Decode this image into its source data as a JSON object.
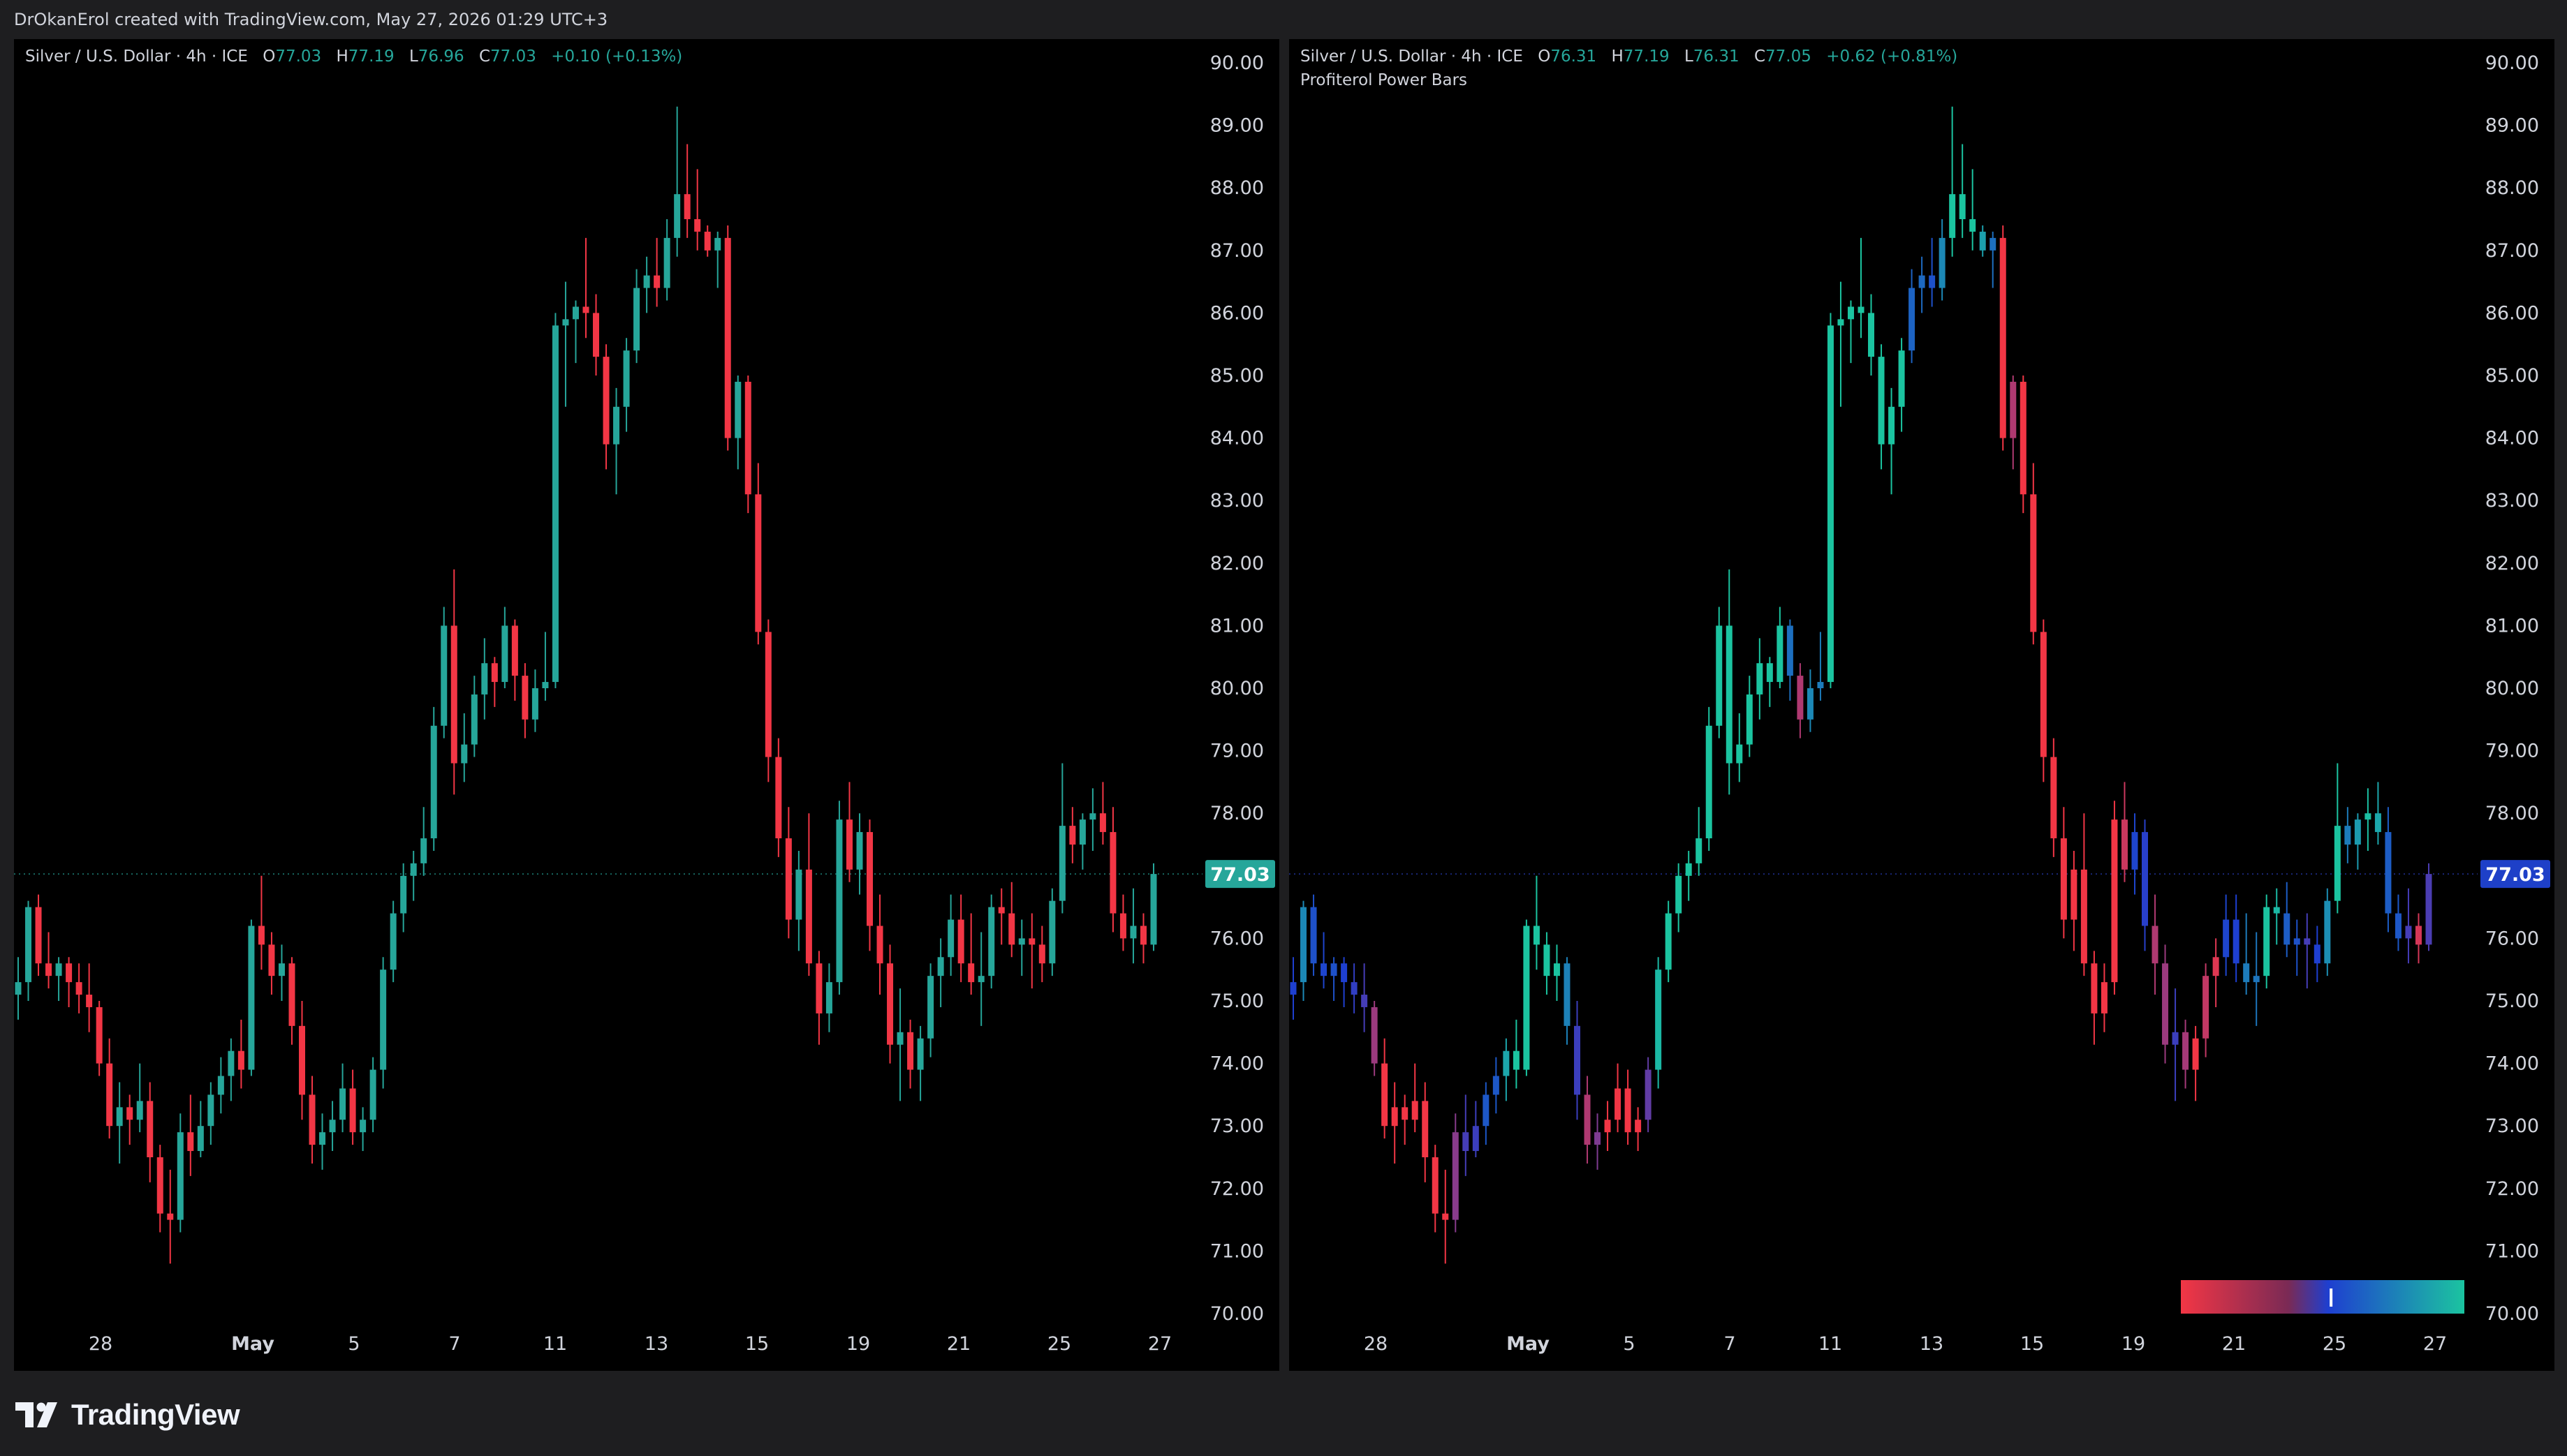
{
  "header": {
    "credit": "DrOkanErol created with TradingView.com, May 27, 2026 01:29 UTC+3"
  },
  "brand": {
    "name": "TradingView",
    "icon": "tradingview-logo-icon"
  },
  "colors": {
    "up": "#26a69a",
    "down": "#f23645",
    "background": "#000000",
    "frame": "#1e1e20",
    "gradient_bear": "#f23645",
    "gradient_neutral": "#1e3fd0",
    "gradient_bull": "#1bc4a0"
  },
  "left_pane": {
    "symbol": "Silver / U.S. Dollar · 4h · ICE",
    "ohlc": {
      "o_label": "O",
      "o": "77.03",
      "h_label": "H",
      "h": "77.19",
      "l_label": "L",
      "l": "76.96",
      "c_label": "C",
      "c": "77.03",
      "change": "+0.10 (+0.13%)"
    },
    "price_tag": "77.03"
  },
  "right_pane": {
    "symbol": "Silver / U.S. Dollar · 4h · ICE",
    "ohlc": {
      "o_label": "O",
      "o": "76.31",
      "h_label": "H",
      "h": "77.19",
      "l_label": "L",
      "l": "76.31",
      "c_label": "C",
      "c": "77.05",
      "change": "+0.62 (+0.81%)"
    },
    "indicator": "Profiterol Power Bars",
    "price_tag": "77.03"
  },
  "chart_data": [
    {
      "type": "candlestick",
      "title": "Silver / U.S. Dollar · 4h · ICE",
      "y_ticks": [
        "90.00",
        "89.00",
        "88.00",
        "87.00",
        "86.00",
        "85.00",
        "84.00",
        "83.00",
        "82.00",
        "81.00",
        "80.00",
        "79.00",
        "78.00",
        "77.00",
        "76.00",
        "75.00",
        "74.00",
        "73.00",
        "72.00",
        "71.00",
        "70.00"
      ],
      "ylim": [
        70,
        90
      ],
      "x_ticks": [
        "28",
        "May",
        "5",
        "7",
        "11",
        "13",
        "15",
        "19",
        "21",
        "25",
        "27"
      ],
      "last_price": 77.03,
      "ohlc": [
        [
          75.1,
          75.7,
          74.7,
          75.3
        ],
        [
          75.3,
          76.6,
          75.0,
          76.5
        ],
        [
          76.5,
          76.7,
          75.4,
          75.6
        ],
        [
          75.6,
          76.1,
          75.2,
          75.4
        ],
        [
          75.4,
          75.7,
          75.0,
          75.6
        ],
        [
          75.6,
          75.7,
          74.9,
          75.3
        ],
        [
          75.3,
          75.6,
          74.8,
          75.1
        ],
        [
          75.1,
          75.6,
          74.5,
          74.9
        ],
        [
          74.9,
          75.0,
          73.8,
          74.0
        ],
        [
          74.0,
          74.4,
          72.8,
          73.0
        ],
        [
          73.0,
          73.7,
          72.4,
          73.3
        ],
        [
          73.3,
          73.5,
          72.7,
          73.1
        ],
        [
          73.1,
          74.0,
          72.9,
          73.4
        ],
        [
          73.4,
          73.7,
          72.1,
          72.5
        ],
        [
          72.5,
          72.7,
          71.3,
          71.6
        ],
        [
          71.6,
          72.3,
          70.8,
          71.5
        ],
        [
          71.5,
          73.2,
          71.3,
          72.9
        ],
        [
          72.9,
          73.5,
          72.2,
          72.6
        ],
        [
          72.6,
          73.4,
          72.5,
          73.0
        ],
        [
          73.0,
          73.7,
          72.7,
          73.5
        ],
        [
          73.5,
          74.1,
          73.2,
          73.8
        ],
        [
          73.8,
          74.4,
          73.4,
          74.2
        ],
        [
          74.2,
          74.7,
          73.6,
          73.9
        ],
        [
          73.9,
          76.3,
          73.8,
          76.2
        ],
        [
          76.2,
          77.0,
          75.5,
          75.9
        ],
        [
          75.9,
          76.1,
          75.1,
          75.4
        ],
        [
          75.4,
          75.9,
          75.0,
          75.6
        ],
        [
          75.6,
          75.7,
          74.3,
          74.6
        ],
        [
          74.6,
          75.0,
          73.1,
          73.5
        ],
        [
          73.5,
          73.8,
          72.4,
          72.7
        ],
        [
          72.7,
          73.2,
          72.3,
          72.9
        ],
        [
          72.9,
          73.4,
          72.6,
          73.1
        ],
        [
          73.1,
          74.0,
          72.9,
          73.6
        ],
        [
          73.6,
          73.9,
          72.7,
          72.9
        ],
        [
          72.9,
          73.3,
          72.6,
          73.1
        ],
        [
          73.1,
          74.1,
          72.9,
          73.9
        ],
        [
          73.9,
          75.7,
          73.6,
          75.5
        ],
        [
          75.5,
          76.6,
          75.3,
          76.4
        ],
        [
          76.4,
          77.2,
          76.1,
          77.0
        ],
        [
          77.0,
          77.4,
          76.6,
          77.2
        ],
        [
          77.2,
          78.1,
          77.0,
          77.6
        ],
        [
          77.6,
          79.7,
          77.4,
          79.4
        ],
        [
          79.4,
          81.3,
          79.2,
          81.0
        ],
        [
          81.0,
          81.9,
          78.3,
          78.8
        ],
        [
          78.8,
          79.6,
          78.5,
          79.1
        ],
        [
          79.1,
          80.2,
          78.9,
          79.9
        ],
        [
          79.9,
          80.8,
          79.5,
          80.4
        ],
        [
          80.4,
          80.5,
          79.7,
          80.1
        ],
        [
          80.1,
          81.3,
          80.0,
          81.0
        ],
        [
          81.0,
          81.1,
          79.8,
          80.2
        ],
        [
          80.2,
          80.4,
          79.2,
          79.5
        ],
        [
          79.5,
          80.3,
          79.3,
          80.0
        ],
        [
          80.0,
          80.9,
          79.8,
          80.1
        ],
        [
          80.1,
          86.0,
          80.0,
          85.8
        ],
        [
          85.8,
          86.5,
          84.5,
          85.9
        ],
        [
          85.9,
          86.2,
          85.2,
          86.1
        ],
        [
          86.1,
          87.2,
          85.6,
          86.0
        ],
        [
          86.0,
          86.3,
          85.0,
          85.3
        ],
        [
          85.3,
          85.5,
          83.5,
          83.9
        ],
        [
          83.9,
          84.8,
          83.1,
          84.5
        ],
        [
          84.5,
          85.6,
          84.1,
          85.4
        ],
        [
          85.4,
          86.7,
          85.2,
          86.4
        ],
        [
          86.4,
          86.9,
          86.0,
          86.6
        ],
        [
          86.6,
          87.2,
          86.1,
          86.4
        ],
        [
          86.4,
          87.5,
          86.2,
          87.2
        ],
        [
          87.2,
          89.3,
          86.9,
          87.9
        ],
        [
          87.9,
          88.7,
          87.2,
          87.5
        ],
        [
          87.5,
          88.3,
          87.0,
          87.3
        ],
        [
          87.3,
          87.4,
          86.9,
          87.0
        ],
        [
          87.0,
          87.3,
          86.4,
          87.2
        ],
        [
          87.2,
          87.4,
          83.8,
          84.0
        ],
        [
          84.0,
          85.0,
          83.5,
          84.9
        ],
        [
          84.9,
          85.0,
          82.8,
          83.1
        ],
        [
          83.1,
          83.6,
          80.7,
          80.9
        ],
        [
          80.9,
          81.1,
          78.5,
          78.9
        ],
        [
          78.9,
          79.2,
          77.3,
          77.6
        ],
        [
          77.6,
          78.1,
          76.0,
          76.3
        ],
        [
          76.3,
          77.4,
          75.8,
          77.1
        ],
        [
          77.1,
          78.0,
          75.4,
          75.6
        ],
        [
          75.6,
          75.8,
          74.3,
          74.8
        ],
        [
          74.8,
          75.6,
          74.5,
          75.3
        ],
        [
          75.3,
          78.2,
          75.1,
          77.9
        ],
        [
          77.9,
          78.5,
          76.9,
          77.1
        ],
        [
          77.1,
          78.0,
          76.7,
          77.7
        ],
        [
          77.7,
          77.9,
          75.8,
          76.2
        ],
        [
          76.2,
          76.7,
          75.1,
          75.6
        ],
        [
          75.6,
          75.9,
          74.0,
          74.3
        ],
        [
          74.3,
          75.2,
          73.4,
          74.5
        ],
        [
          74.5,
          74.7,
          73.6,
          73.9
        ],
        [
          73.9,
          74.6,
          73.4,
          74.4
        ],
        [
          74.4,
          75.6,
          74.1,
          75.4
        ],
        [
          75.4,
          76.0,
          74.9,
          75.7
        ],
        [
          75.7,
          76.7,
          75.4,
          76.3
        ],
        [
          76.3,
          76.7,
          75.3,
          75.6
        ],
        [
          75.6,
          76.4,
          75.1,
          75.3
        ],
        [
          75.3,
          76.1,
          74.6,
          75.4
        ],
        [
          75.4,
          76.7,
          75.2,
          76.5
        ],
        [
          76.5,
          76.8,
          75.9,
          76.4
        ],
        [
          76.4,
          76.9,
          75.7,
          75.9
        ],
        [
          75.9,
          76.3,
          75.4,
          76.0
        ],
        [
          76.0,
          76.4,
          75.2,
          75.9
        ],
        [
          75.9,
          76.2,
          75.3,
          75.6
        ],
        [
          75.6,
          76.8,
          75.4,
          76.6
        ],
        [
          76.6,
          78.8,
          76.4,
          77.8
        ],
        [
          77.8,
          78.1,
          77.2,
          77.5
        ],
        [
          77.5,
          78.0,
          77.1,
          77.9
        ],
        [
          77.9,
          78.4,
          77.4,
          78.0
        ],
        [
          78.0,
          78.5,
          77.5,
          77.7
        ],
        [
          77.7,
          78.1,
          76.1,
          76.4
        ],
        [
          76.4,
          76.7,
          75.8,
          76.0
        ],
        [
          76.0,
          76.8,
          75.6,
          76.2
        ],
        [
          76.2,
          76.4,
          75.6,
          75.9
        ],
        [
          75.9,
          77.2,
          75.8,
          77.03
        ]
      ]
    },
    {
      "type": "candlestick",
      "title": "Silver / U.S. Dollar · 4h · ICE",
      "indicator": "Profiterol Power Bars",
      "ylim": [
        70,
        90
      ],
      "x_ticks": [
        "28",
        "May",
        "5",
        "7",
        "11",
        "13",
        "15",
        "19",
        "21",
        "25",
        "27"
      ],
      "last_price": 77.03,
      "coloring": "gradient from bear (red) through neutral (blue) to bull (teal)"
    }
  ]
}
